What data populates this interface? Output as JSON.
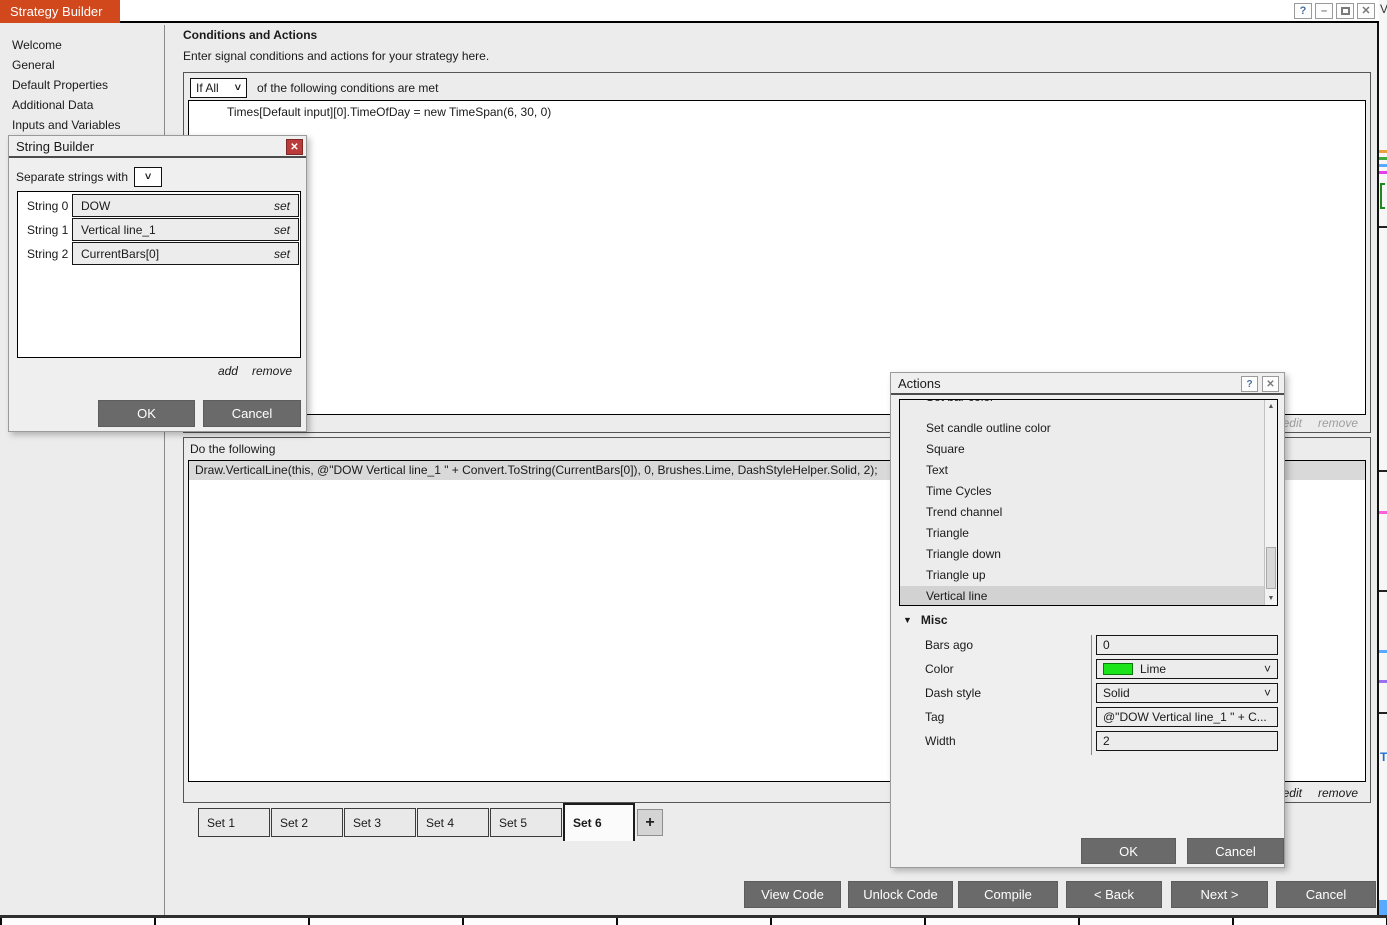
{
  "window": {
    "title": "Strategy Builder",
    "controls": {
      "help": "?",
      "minimize": "–",
      "close": "✕"
    },
    "edge_marks": {
      "top": "V",
      "chart": "T"
    }
  },
  "icons": {
    "chevron_down": "˅",
    "expander_down": "▼",
    "scroll_up": "▲",
    "scroll_down": "▼",
    "close": "✕"
  },
  "sidebar": {
    "items": [
      {
        "label": "Welcome"
      },
      {
        "label": "General"
      },
      {
        "label": "Default Properties"
      },
      {
        "label": "Additional Data"
      },
      {
        "label": "Inputs and Variables"
      }
    ]
  },
  "main": {
    "heading": "Conditions and Actions",
    "subheading": "Enter signal conditions and actions for your strategy here.",
    "conditions": {
      "match_selector": "If All",
      "match_suffix": "of the following conditions are met",
      "rows": [
        "Times[Default input][0].TimeOfDay = new TimeSpan(6, 30, 0)"
      ],
      "edit_label": "edit",
      "remove_label": "remove"
    },
    "do_section": {
      "label": "Do the following",
      "rows": [
        "Draw.VerticalLine(this, @\"DOW Vertical line_1 \" + Convert.ToString(CurrentBars[0]), 0, Brushes.Lime, DashStyleHelper.Solid, 2);"
      ],
      "edit_label": "edit",
      "remove_label": "remove"
    },
    "tabs": {
      "items": [
        "Set 1",
        "Set 2",
        "Set 3",
        "Set 4",
        "Set 5",
        "Set 6"
      ],
      "active": "Set 6",
      "add_label": "+"
    },
    "footer_buttons": [
      "View Code",
      "Unlock Code",
      "Compile",
      "< Back",
      "Next >",
      "Cancel"
    ]
  },
  "string_builder": {
    "title": "String Builder",
    "separator_label": "Separate strings with",
    "rows": [
      {
        "label": "String 0",
        "value": "DOW",
        "action": "set"
      },
      {
        "label": "String 1",
        "value": "Vertical line_1",
        "action": "set"
      },
      {
        "label": "String 2",
        "value": "CurrentBars[0]",
        "action": "set"
      }
    ],
    "add_label": "add",
    "remove_label": "remove",
    "ok_label": "OK",
    "cancel_label": "Cancel"
  },
  "actions_dialog": {
    "title": "Actions",
    "list": {
      "clipped_top_item": "Set bar color",
      "items": [
        "Set candle outline color",
        "Square",
        "Text",
        "Time Cycles",
        "Trend channel",
        "Triangle",
        "Triangle down",
        "Triangle up",
        "Vertical line"
      ],
      "selected": "Vertical line"
    },
    "properties": {
      "group": "Misc",
      "rows": [
        {
          "label": "Bars ago",
          "value": "0"
        },
        {
          "label": "Color",
          "value": "Lime"
        },
        {
          "label": "Dash style",
          "value": "Solid"
        },
        {
          "label": "Tag",
          "value": "@\"DOW Vertical line_1 \" + C..."
        },
        {
          "label": "Width",
          "value": "2"
        }
      ]
    },
    "ok_label": "OK",
    "cancel_label": "Cancel"
  },
  "colors": {
    "accent_orange": "#d1481d",
    "button_gray": "#6a6a6a",
    "lime_swatch": "#1ae41a",
    "selection_gray": "#d9d9d9"
  }
}
